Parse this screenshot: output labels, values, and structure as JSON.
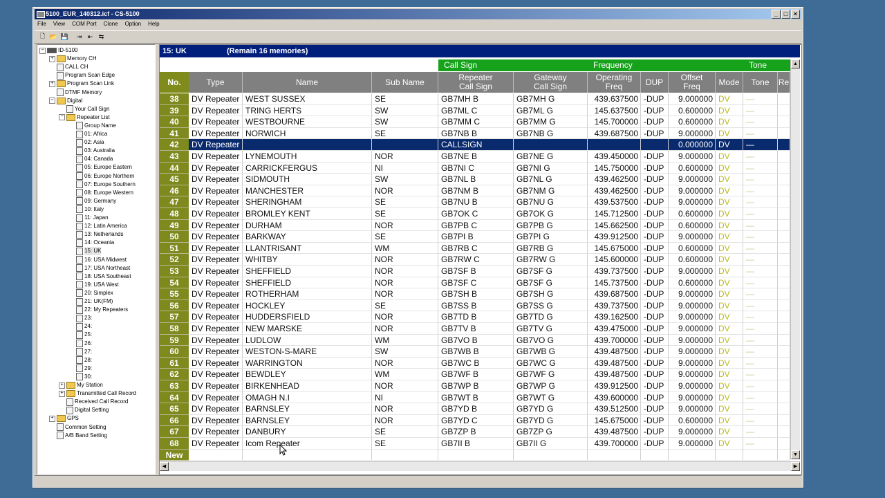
{
  "window": {
    "title": "5100_EUR_140312.icf - CS-5100",
    "minimize": "_",
    "maximize": "□",
    "close": "×"
  },
  "menu": [
    "File",
    "View",
    "COM Port",
    "Clone",
    "Option",
    "Help"
  ],
  "toolbar": [
    "new-file-icon",
    "open-folder-icon",
    "save-disk-icon",
    "read-radio-icon",
    "write-radio-icon",
    "clone-radio-icon"
  ],
  "tree": [
    {
      "label": "ID-5100",
      "level": 0,
      "expander": "−",
      "icon": "radio"
    },
    {
      "label": "Memory CH",
      "level": 1,
      "expander": "+",
      "icon": "folder"
    },
    {
      "label": "CALL CH",
      "level": 1,
      "expander": "",
      "icon": "doc"
    },
    {
      "label": "Program Scan Edge",
      "level": 1,
      "expander": "",
      "icon": "doc"
    },
    {
      "label": "Program Scan Link",
      "level": 1,
      "expander": "+",
      "icon": "folder"
    },
    {
      "label": "DTMF Memory",
      "level": 1,
      "expander": "",
      "icon": "doc"
    },
    {
      "label": "Digital",
      "level": 1,
      "expander": "−",
      "icon": "folder"
    },
    {
      "label": "Your Call Sign",
      "level": 2,
      "expander": "",
      "icon": "doc"
    },
    {
      "label": "Repeater List",
      "level": 2,
      "expander": "−",
      "icon": "folder"
    },
    {
      "label": "Group Name",
      "level": 3,
      "expander": "",
      "icon": "doc"
    },
    {
      "label": "01: Africa",
      "level": 3,
      "expander": "",
      "icon": "doc"
    },
    {
      "label": "02: Asia",
      "level": 3,
      "expander": "",
      "icon": "doc"
    },
    {
      "label": "03: Australia",
      "level": 3,
      "expander": "",
      "icon": "doc"
    },
    {
      "label": "04: Canada",
      "level": 3,
      "expander": "",
      "icon": "doc"
    },
    {
      "label": "05: Europe Eastern",
      "level": 3,
      "expander": "",
      "icon": "doc"
    },
    {
      "label": "06: Europe Northern",
      "level": 3,
      "expander": "",
      "icon": "doc"
    },
    {
      "label": "07: Europe Southern",
      "level": 3,
      "expander": "",
      "icon": "doc"
    },
    {
      "label": "08: Europe Western",
      "level": 3,
      "expander": "",
      "icon": "doc"
    },
    {
      "label": "09: Germany",
      "level": 3,
      "expander": "",
      "icon": "doc"
    },
    {
      "label": "10: Italy",
      "level": 3,
      "expander": "",
      "icon": "doc"
    },
    {
      "label": "11: Japan",
      "level": 3,
      "expander": "",
      "icon": "doc"
    },
    {
      "label": "12: Latin America",
      "level": 3,
      "expander": "",
      "icon": "doc"
    },
    {
      "label": "13: Netherlands",
      "level": 3,
      "expander": "",
      "icon": "doc"
    },
    {
      "label": "14: Oceania",
      "level": 3,
      "expander": "",
      "icon": "doc"
    },
    {
      "label": "15: UK",
      "level": 3,
      "expander": "",
      "icon": "doc",
      "selected": true
    },
    {
      "label": "16: USA Midwest",
      "level": 3,
      "expander": "",
      "icon": "doc"
    },
    {
      "label": "17: USA Northeast",
      "level": 3,
      "expander": "",
      "icon": "doc"
    },
    {
      "label": "18: USA Southeast",
      "level": 3,
      "expander": "",
      "icon": "doc"
    },
    {
      "label": "19: USA West",
      "level": 3,
      "expander": "",
      "icon": "doc"
    },
    {
      "label": "20: Simplex",
      "level": 3,
      "expander": "",
      "icon": "doc"
    },
    {
      "label": "21: UK(FM)",
      "level": 3,
      "expander": "",
      "icon": "doc"
    },
    {
      "label": "22: My Repeaters",
      "level": 3,
      "expander": "",
      "icon": "doc"
    },
    {
      "label": "23:",
      "level": 3,
      "expander": "",
      "icon": "doc"
    },
    {
      "label": "24:",
      "level": 3,
      "expander": "",
      "icon": "doc"
    },
    {
      "label": "25:",
      "level": 3,
      "expander": "",
      "icon": "doc"
    },
    {
      "label": "26:",
      "level": 3,
      "expander": "",
      "icon": "doc"
    },
    {
      "label": "27:",
      "level": 3,
      "expander": "",
      "icon": "doc"
    },
    {
      "label": "28:",
      "level": 3,
      "expander": "",
      "icon": "doc"
    },
    {
      "label": "29:",
      "level": 3,
      "expander": "",
      "icon": "doc"
    },
    {
      "label": "30:",
      "level": 3,
      "expander": "",
      "icon": "doc"
    },
    {
      "label": "My Station",
      "level": 2,
      "expander": "+",
      "icon": "folder"
    },
    {
      "label": "Transmitted Call Record",
      "level": 2,
      "expander": "+",
      "icon": "folder"
    },
    {
      "label": "Received Call Record",
      "level": 2,
      "expander": "",
      "icon": "doc"
    },
    {
      "label": "Digital Setting",
      "level": 2,
      "expander": "",
      "icon": "doc"
    },
    {
      "label": "GPS",
      "level": 1,
      "expander": "+",
      "icon": "folder"
    },
    {
      "label": "Common Setting",
      "level": 1,
      "expander": "",
      "icon": "doc"
    },
    {
      "label": "A/B Band Setting",
      "level": 1,
      "expander": "",
      "icon": "doc"
    }
  ],
  "infobar": {
    "group": "15: UK",
    "remain": "(Remain  16 memories)"
  },
  "group_headers": {
    "call_sign": "Call Sign",
    "frequency": "Frequency",
    "tone": "Tone"
  },
  "columns": {
    "no": "No.",
    "type": "Type",
    "name": "Name",
    "sub_name": "Sub Name",
    "repeater_cs_1": "Repeater",
    "repeater_cs_2": "Call Sign",
    "gateway_cs_1": "Gateway",
    "gateway_cs_2": "Call Sign",
    "op_freq_1": "Operating",
    "op_freq_2": "Freq",
    "dup": "DUP",
    "offset_1": "Offset",
    "offset_2": "Freq",
    "mode": "Mode",
    "tone": "Tone",
    "extra": "Re"
  },
  "rows": [
    {
      "no": "38",
      "type": "DV Repeater",
      "name": "WEST SUSSEX",
      "sub": "SE",
      "rpt": "GB7MH  B",
      "gw": "GB7MH  G",
      "freq": "439.637500",
      "dup": "-DUP",
      "offset": "9.000000",
      "mode": "DV",
      "tone": "—"
    },
    {
      "no": "39",
      "type": "DV Repeater",
      "name": "TRING HERTS",
      "sub": "SW",
      "rpt": "GB7ML  C",
      "gw": "GB7ML  G",
      "freq": "145.637500",
      "dup": "-DUP",
      "offset": "0.600000",
      "mode": "DV",
      "tone": "—"
    },
    {
      "no": "40",
      "type": "DV Repeater",
      "name": "WESTBOURNE",
      "sub": "SW",
      "rpt": "GB7MM  C",
      "gw": "GB7MM  G",
      "freq": "145.700000",
      "dup": "-DUP",
      "offset": "0.600000",
      "mode": "DV",
      "tone": "—"
    },
    {
      "no": "41",
      "type": "DV Repeater",
      "name": "NORWICH",
      "sub": "SE",
      "rpt": "GB7NB  B",
      "gw": "GB7NB  G",
      "freq": "439.687500",
      "dup": "-DUP",
      "offset": "9.000000",
      "mode": "DV",
      "tone": "—"
    },
    {
      "no": "42",
      "type": "DV Repeater",
      "name": "",
      "sub": "",
      "rpt": "CALLSIGN",
      "gw": "",
      "freq": "",
      "dup": "",
      "offset": "0.000000",
      "mode": "DV",
      "tone": "—",
      "selected": true
    },
    {
      "no": "43",
      "type": "DV Repeater",
      "name": "LYNEMOUTH",
      "sub": "NOR",
      "rpt": "GB7NE  B",
      "gw": "GB7NE  G",
      "freq": "439.450000",
      "dup": "-DUP",
      "offset": "9.000000",
      "mode": "DV",
      "tone": "—"
    },
    {
      "no": "44",
      "type": "DV Repeater",
      "name": "CARRICKFERGUS",
      "sub": "NI",
      "rpt": "GB7NI  C",
      "gw": "GB7NI  G",
      "freq": "145.750000",
      "dup": "-DUP",
      "offset": "0.600000",
      "mode": "DV",
      "tone": "—"
    },
    {
      "no": "45",
      "type": "DV Repeater",
      "name": "SIDMOUTH",
      "sub": "SW",
      "rpt": "GB7NL  B",
      "gw": "GB7NL  G",
      "freq": "439.462500",
      "dup": "-DUP",
      "offset": "9.000000",
      "mode": "DV",
      "tone": "—"
    },
    {
      "no": "46",
      "type": "DV Repeater",
      "name": "MANCHESTER",
      "sub": "NOR",
      "rpt": "GB7NM  B",
      "gw": "GB7NM  G",
      "freq": "439.462500",
      "dup": "-DUP",
      "offset": "9.000000",
      "mode": "DV",
      "tone": "—"
    },
    {
      "no": "47",
      "type": "DV Repeater",
      "name": "SHERINGHAM",
      "sub": "SE",
      "rpt": "GB7NU  B",
      "gw": "GB7NU  G",
      "freq": "439.537500",
      "dup": "-DUP",
      "offset": "9.000000",
      "mode": "DV",
      "tone": "—"
    },
    {
      "no": "48",
      "type": "DV Repeater",
      "name": "BROMLEY KENT",
      "sub": "SE",
      "rpt": "GB7OK  C",
      "gw": "GB7OK  G",
      "freq": "145.712500",
      "dup": "-DUP",
      "offset": "0.600000",
      "mode": "DV",
      "tone": "—"
    },
    {
      "no": "49",
      "type": "DV Repeater",
      "name": "DURHAM",
      "sub": "NOR",
      "rpt": "GB7PB  C",
      "gw": "GB7PB  G",
      "freq": "145.662500",
      "dup": "-DUP",
      "offset": "0.600000",
      "mode": "DV",
      "tone": "—"
    },
    {
      "no": "50",
      "type": "DV Repeater",
      "name": "BARKWAY",
      "sub": "SE",
      "rpt": "GB7PI  B",
      "gw": "GB7PI  G",
      "freq": "439.912500",
      "dup": "-DUP",
      "offset": "9.000000",
      "mode": "DV",
      "tone": "—"
    },
    {
      "no": "51",
      "type": "DV Repeater",
      "name": "LLANTRISANT",
      "sub": "WM",
      "rpt": "GB7RB  C",
      "gw": "GB7RB  G",
      "freq": "145.675000",
      "dup": "-DUP",
      "offset": "0.600000",
      "mode": "DV",
      "tone": "—"
    },
    {
      "no": "52",
      "type": "DV Repeater",
      "name": "WHITBY",
      "sub": "NOR",
      "rpt": "GB7RW  C",
      "gw": "GB7RW  G",
      "freq": "145.600000",
      "dup": "-DUP",
      "offset": "0.600000",
      "mode": "DV",
      "tone": "—"
    },
    {
      "no": "53",
      "type": "DV Repeater",
      "name": "SHEFFIELD",
      "sub": "NOR",
      "rpt": "GB7SF  B",
      "gw": "GB7SF  G",
      "freq": "439.737500",
      "dup": "-DUP",
      "offset": "9.000000",
      "mode": "DV",
      "tone": "—"
    },
    {
      "no": "54",
      "type": "DV Repeater",
      "name": "SHEFFIELD",
      "sub": "NOR",
      "rpt": "GB7SF  C",
      "gw": "GB7SF  G",
      "freq": "145.737500",
      "dup": "-DUP",
      "offset": "0.600000",
      "mode": "DV",
      "tone": "—"
    },
    {
      "no": "55",
      "type": "DV Repeater",
      "name": "ROTHERHAM",
      "sub": "NOR",
      "rpt": "GB7SH  B",
      "gw": "GB7SH  G",
      "freq": "439.687500",
      "dup": "-DUP",
      "offset": "9.000000",
      "mode": "DV",
      "tone": "—"
    },
    {
      "no": "56",
      "type": "DV Repeater",
      "name": "HOCKLEY",
      "sub": "SE",
      "rpt": "GB7SS  B",
      "gw": "GB7SS  G",
      "freq": "439.737500",
      "dup": "-DUP",
      "offset": "9.000000",
      "mode": "DV",
      "tone": "—"
    },
    {
      "no": "57",
      "type": "DV Repeater",
      "name": "HUDDERSFIELD",
      "sub": "NOR",
      "rpt": "GB7TD  B",
      "gw": "GB7TD  G",
      "freq": "439.162500",
      "dup": "-DUP",
      "offset": "9.000000",
      "mode": "DV",
      "tone": "—"
    },
    {
      "no": "58",
      "type": "DV Repeater",
      "name": "NEW MARSKE",
      "sub": "NOR",
      "rpt": "GB7TV  B",
      "gw": "GB7TV  G",
      "freq": "439.475000",
      "dup": "-DUP",
      "offset": "9.000000",
      "mode": "DV",
      "tone": "—"
    },
    {
      "no": "59",
      "type": "DV Repeater",
      "name": "LUDLOW",
      "sub": "WM",
      "rpt": "GB7VO  B",
      "gw": "GB7VO  G",
      "freq": "439.700000",
      "dup": "-DUP",
      "offset": "9.000000",
      "mode": "DV",
      "tone": "—"
    },
    {
      "no": "60",
      "type": "DV Repeater",
      "name": "WESTON-S-MARE",
      "sub": "SW",
      "rpt": "GB7WB  B",
      "gw": "GB7WB  G",
      "freq": "439.487500",
      "dup": "-DUP",
      "offset": "9.000000",
      "mode": "DV",
      "tone": "—"
    },
    {
      "no": "61",
      "type": "DV Repeater",
      "name": "WARRINGTON",
      "sub": "NOR",
      "rpt": "GB7WC  B",
      "gw": "GB7WC  G",
      "freq": "439.487500",
      "dup": "-DUP",
      "offset": "9.000000",
      "mode": "DV",
      "tone": "—"
    },
    {
      "no": "62",
      "type": "DV Repeater",
      "name": "BEWDLEY",
      "sub": "WM",
      "rpt": "GB7WF  B",
      "gw": "GB7WF  G",
      "freq": "439.487500",
      "dup": "-DUP",
      "offset": "9.000000",
      "mode": "DV",
      "tone": "—"
    },
    {
      "no": "63",
      "type": "DV Repeater",
      "name": "BIRKENHEAD",
      "sub": "NOR",
      "rpt": "GB7WP  B",
      "gw": "GB7WP  G",
      "freq": "439.912500",
      "dup": "-DUP",
      "offset": "9.000000",
      "mode": "DV",
      "tone": "—"
    },
    {
      "no": "64",
      "type": "DV Repeater",
      "name": "OMAGH N.I",
      "sub": "NI",
      "rpt": "GB7WT  B",
      "gw": "GB7WT  G",
      "freq": "439.600000",
      "dup": "-DUP",
      "offset": "9.000000",
      "mode": "DV",
      "tone": "—"
    },
    {
      "no": "65",
      "type": "DV Repeater",
      "name": "BARNSLEY",
      "sub": "NOR",
      "rpt": "GB7YD  B",
      "gw": "GB7YD  G",
      "freq": "439.512500",
      "dup": "-DUP",
      "offset": "9.000000",
      "mode": "DV",
      "tone": "—"
    },
    {
      "no": "66",
      "type": "DV Repeater",
      "name": "BARNSLEY",
      "sub": "NOR",
      "rpt": "GB7YD  C",
      "gw": "GB7YD  G",
      "freq": "145.675000",
      "dup": "-DUP",
      "offset": "0.600000",
      "mode": "DV",
      "tone": "—"
    },
    {
      "no": "67",
      "type": "DV Repeater",
      "name": "DANBURY",
      "sub": "SE",
      "rpt": "GB7ZP  B",
      "gw": "GB7ZP  G",
      "freq": "439.487500",
      "dup": "-DUP",
      "offset": "9.000000",
      "mode": "DV",
      "tone": "—"
    },
    {
      "no": "68",
      "type": "DV Repeater",
      "name": "Icom Repeater",
      "sub": "SE",
      "rpt": "GB7II  B",
      "gw": "GB7II  G",
      "freq": "439.700000",
      "dup": "-DUP",
      "offset": "9.000000",
      "mode": "DV",
      "tone": "—"
    },
    {
      "no": "New",
      "type": "",
      "name": "",
      "sub": "",
      "rpt": "",
      "gw": "",
      "freq": "",
      "dup": "",
      "offset": "",
      "mode": "",
      "tone": ""
    }
  ],
  "colors": {
    "title_bar": "#0a246a",
    "info_bar": "#001e7c",
    "group_header": "#16a21a",
    "column_header": "#808080",
    "no_column": "#7e8a1e",
    "selected_row": "#0a2a6e",
    "mode_text": "#b8b820",
    "desktop": "#3f6c96"
  }
}
